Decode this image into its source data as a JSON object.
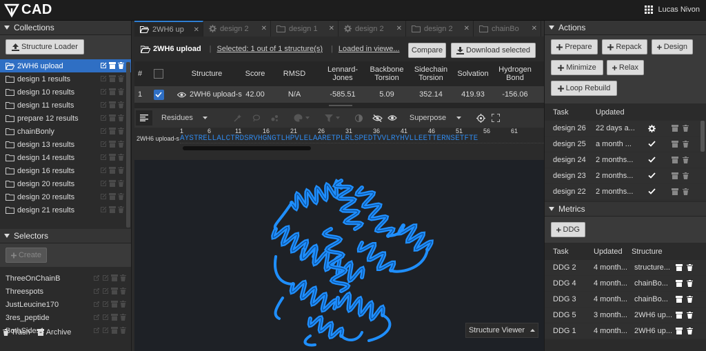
{
  "app": {
    "title": "CAD",
    "user": "Lucas Nivon"
  },
  "collections": {
    "title": "Collections",
    "loader_label": "Structure Loader",
    "items": [
      {
        "label": "2WH6 upload",
        "selected": true
      },
      {
        "label": "design 1 results"
      },
      {
        "label": "design 10 results"
      },
      {
        "label": "design 11 results"
      },
      {
        "label": "prepare 12 results"
      },
      {
        "label": "chainBonly"
      },
      {
        "label": "design 13 results"
      },
      {
        "label": "design 14 results"
      },
      {
        "label": "design 16 results"
      },
      {
        "label": "design 20 results"
      },
      {
        "label": "design 20 results"
      },
      {
        "label": "design 21 results"
      }
    ]
  },
  "selectors": {
    "title": "Selectors",
    "create_label": "Create",
    "items": [
      "ThreeOnChainB",
      "Threespots",
      "JustLeucine170",
      "3res_peptide",
      "BothSides1"
    ]
  },
  "footer": {
    "trash": "Trash",
    "archive": "Archive"
  },
  "tabs": [
    {
      "label": "2WH6 up",
      "icon": "folder-open-icon",
      "active": true
    },
    {
      "label": "design 2",
      "icon": "gear-icon"
    },
    {
      "label": "design 1",
      "icon": "folder-icon"
    },
    {
      "label": "design 2",
      "icon": "gear-icon"
    },
    {
      "label": "design 2",
      "icon": "folder-icon"
    },
    {
      "label": "chainBo",
      "icon": "folder-icon"
    }
  ],
  "collection_bar": {
    "name": "2WH6 upload",
    "selected_text": "Selected: 1 out of 1 structure(s)",
    "loaded_text": "Loaded in viewe...",
    "compare_label": "Compare",
    "download_label": "Download selected"
  },
  "table": {
    "headers": [
      "#",
      "",
      "Structure",
      "Score",
      "RMSD",
      "Lennard-Jones",
      "Backbone Torsion",
      "Sidechain Torsion",
      "Solvation",
      "Hydrogen Bond"
    ],
    "row": {
      "num": "1",
      "structure": "2WH6 upload-s",
      "score": "42.00",
      "rmsd": "N/A",
      "lj": "-585.51",
      "bb": "5.09",
      "sc": "352.14",
      "solv": "419.93",
      "hb": "-156.06"
    }
  },
  "viewer_toolbar": {
    "residues": "Residues",
    "superpose": "Superpose"
  },
  "sequence": {
    "label": "2WH6 upload-s",
    "ticks": [
      "1",
      "6",
      "11",
      "16",
      "21",
      "26",
      "31",
      "36",
      "41",
      "46",
      "51",
      "56",
      "61"
    ],
    "residues": "AYSTRELLALCTRDSRVHGNGTLHPVLELAARETPLRLSPEDTVVLRYHVLLEETTERNSETFTE"
  },
  "viewer": {
    "mode_label": "Structure Viewer"
  },
  "actions": {
    "title": "Actions",
    "buttons": [
      "Prepare",
      "Repack",
      "Design",
      "Minimize",
      "Relax",
      "Loop Rebuild"
    ],
    "task_header": "Task",
    "updated_header": "Updated",
    "tasks": [
      {
        "task": "design 26",
        "updated": "22 days a...",
        "status": "running"
      },
      {
        "task": "design 25",
        "updated": "a month ...",
        "status": "done"
      },
      {
        "task": "design 24",
        "updated": "2 months...",
        "status": "done"
      },
      {
        "task": "design 23",
        "updated": "2 months...",
        "status": "done"
      },
      {
        "task": "design 22",
        "updated": "2 months...",
        "status": "done"
      }
    ]
  },
  "metrics": {
    "title": "Metrics",
    "ddg_label": "DDG",
    "headers": [
      "Task",
      "Updated",
      "Structure"
    ],
    "rows": [
      {
        "task": "DDG 2",
        "updated": "4 month...",
        "structure": "structure..."
      },
      {
        "task": "DDG 4",
        "updated": "4 month...",
        "structure": "chainBo..."
      },
      {
        "task": "DDG 3",
        "updated": "4 month...",
        "structure": "chainBo..."
      },
      {
        "task": "DDG 5",
        "updated": "3 month...",
        "structure": "2WH6 up..."
      },
      {
        "task": "DDG 1",
        "updated": "4 month...",
        "structure": "2WH6 up..."
      }
    ]
  },
  "colors": {
    "accent": "#2f7fd4",
    "protein": "#1f8fff",
    "selected": "#2f6fc4"
  }
}
